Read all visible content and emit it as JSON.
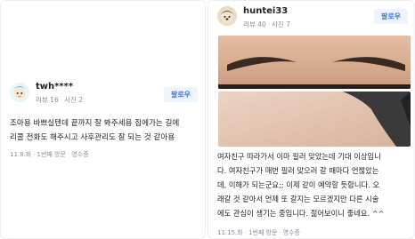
{
  "reviews": [
    {
      "username": "twh****",
      "review_count": "리뷰 16",
      "photo_count": "사진 2",
      "follow_label": "팔로우",
      "text_lines": [
        "조아용 바쁘실텐데 끝까지 잘 봐주세용 집에가는 길에",
        "리콜 전화도 해주시고 사후관리도 잘 되는 것 같아용"
      ],
      "date": "11.8.화",
      "visit": "1번째 방문",
      "receipt": "영수증"
    },
    {
      "username": "huntei33",
      "review_count": "리뷰 40",
      "photo_count": "사진 7",
      "follow_label": "팔로우",
      "text_lines": [
        "여자친구 따라가서 이마 필러 맞았는데 기대 이상입니",
        "다. 여자친구가 매번 필러 맞으러 갈 때마다 언짢았는",
        "데, 이해가 되는군요;; 이제 같이 예약할 듯합니다. 오",
        "래갈 것 같아서 언제 또 갈지는 모르겠지만 다른 시술",
        "에도 관심이 생기는 중입니다. 젊어보이니 좋네요. ^^"
      ],
      "date": "11.15.화",
      "visit": "1번째 방문",
      "receipt": "영수증"
    }
  ],
  "colors": {
    "follow_text": "#3f74e8",
    "follow_bg": "#eef4ff",
    "meta_gray": "#8a8f98"
  },
  "icons": {
    "avatar_left": "cartoon-avatar-icon",
    "avatar_right": "profile-photo"
  }
}
